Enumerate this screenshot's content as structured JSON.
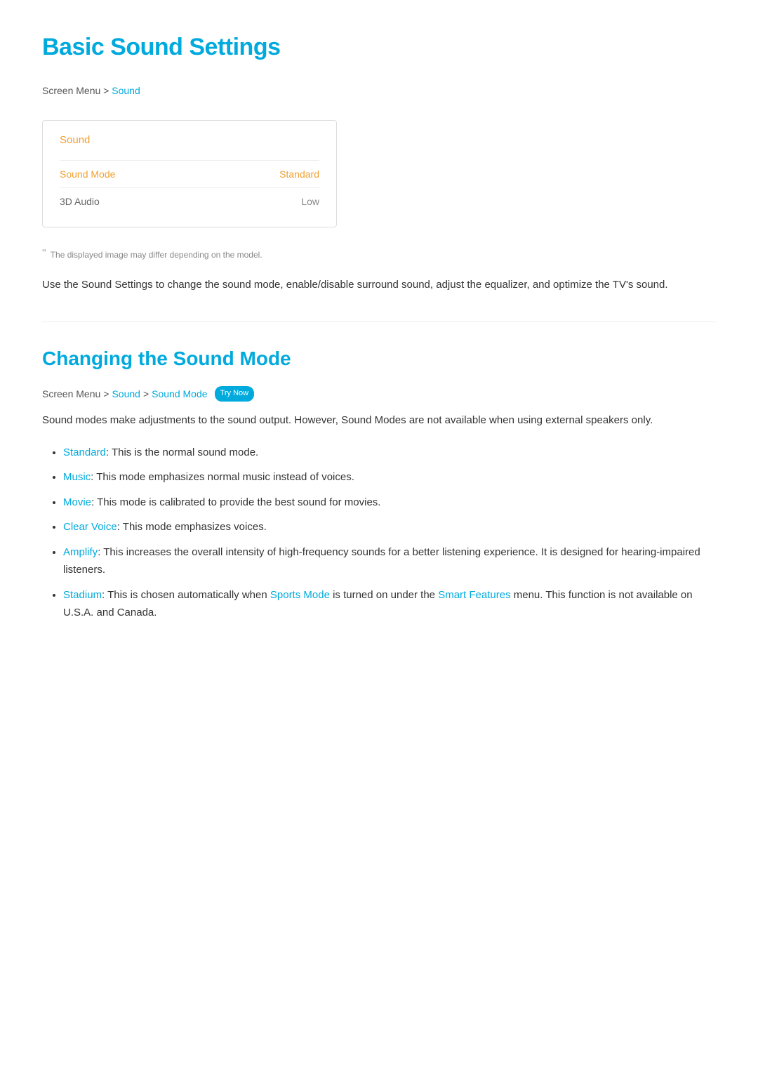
{
  "page": {
    "title": "Basic Sound Settings",
    "breadcrumb": {
      "prefix": "Screen Menu",
      "separator": ">",
      "link_text": "Sound"
    },
    "menu_box": {
      "header": "Sound",
      "rows": [
        {
          "label": "Sound Mode",
          "value": "Standard",
          "style": "highlight"
        },
        {
          "label": "3D Audio",
          "value": "Low",
          "style": "gray"
        }
      ]
    },
    "disclaimer": "The displayed image may differ depending on the model.",
    "description": "Use the Sound Settings to change the sound mode, enable/disable surround sound, adjust the equalizer, and optimize the TV's sound.",
    "section": {
      "title": "Changing the Sound Mode",
      "breadcrumb": {
        "prefix": "Screen Menu",
        "separator": ">",
        "links": [
          "Sound",
          "Sound Mode"
        ],
        "badge": "Try Now"
      },
      "intro": "Sound modes make adjustments to the sound output. However, Sound Modes are not available when using external speakers only.",
      "items": [
        {
          "term": "Standard",
          "text": ": This is the normal sound mode."
        },
        {
          "term": "Music",
          "text": ": This mode emphasizes normal music instead of voices."
        },
        {
          "term": "Movie",
          "text": ": This mode is calibrated to provide the best sound for movies."
        },
        {
          "term": "Clear Voice",
          "text": ": This mode emphasizes voices."
        },
        {
          "term": "Amplify",
          "text": ": This increases the overall intensity of high-frequency sounds for a better listening experience. It is designed for hearing-impaired listeners."
        },
        {
          "term": "Stadium",
          "text_before": ": This is chosen automatically when ",
          "term2": "Sports Mode",
          "text_middle": " is turned on under the ",
          "term3": "Smart Features",
          "text_after": " menu. This function is not available on U.S.A. and Canada."
        }
      ]
    }
  }
}
